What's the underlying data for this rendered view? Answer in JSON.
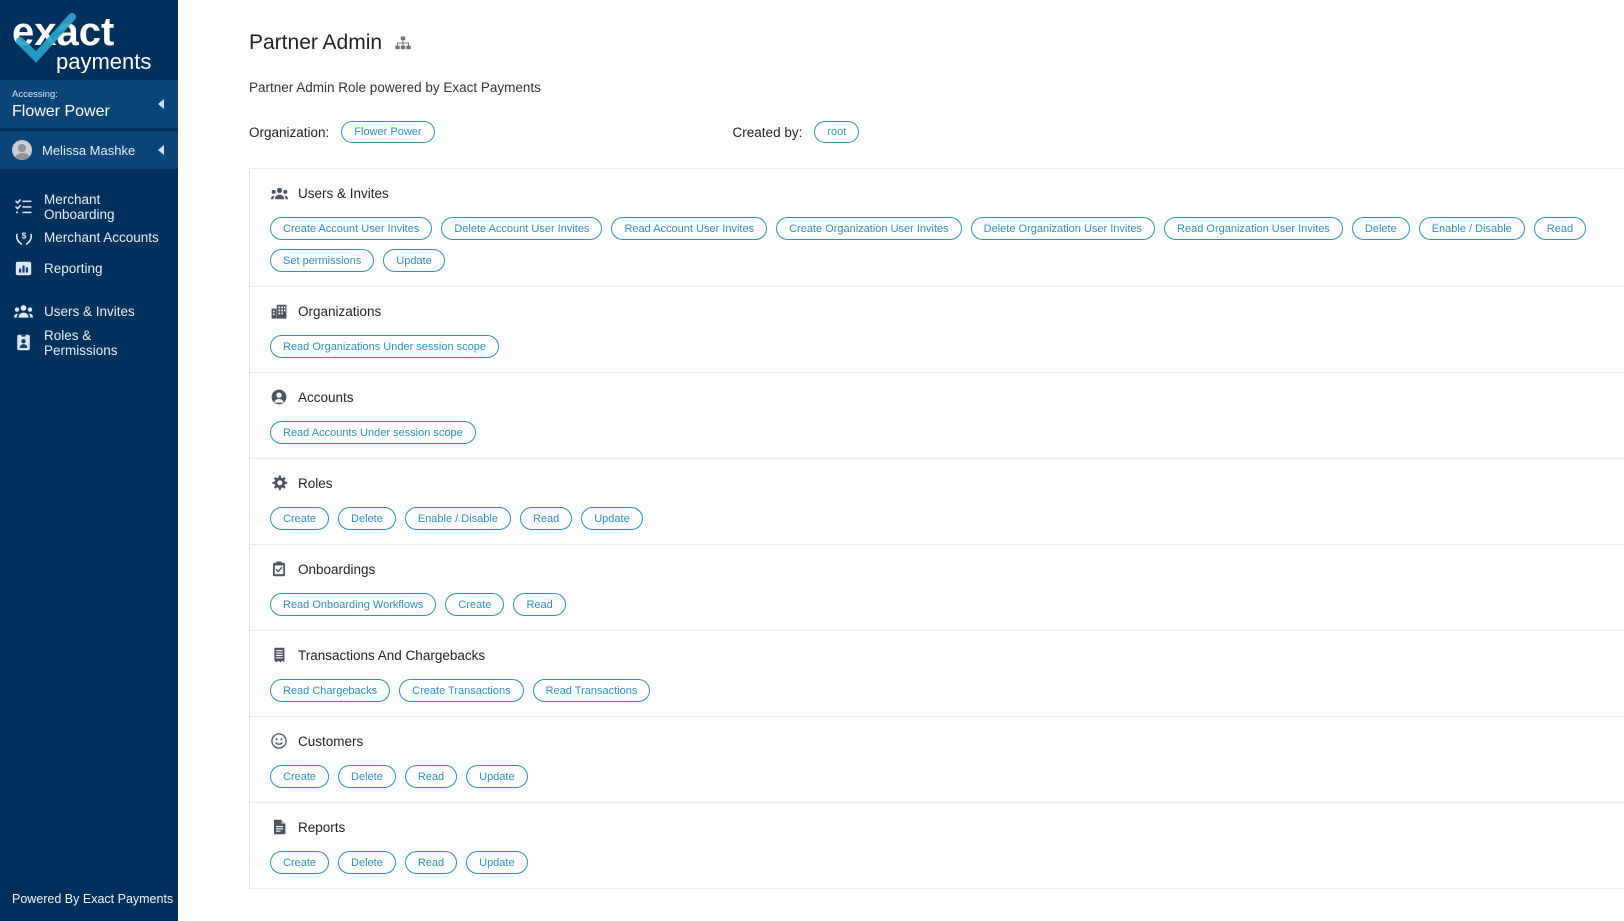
{
  "sidebar": {
    "logo": {
      "brand_top": "exact",
      "brand_bottom": "payments",
      "check_color": "#29a3c9"
    },
    "accessing_label": "Accessing:",
    "accessing_value": "Flower Power",
    "user_name": "Melissa Mashke",
    "nav_items": [
      {
        "label": "Merchant Onboarding",
        "icon": "checklist-icon"
      },
      {
        "label": "Merchant Accounts",
        "icon": "hand-money-icon"
      },
      {
        "label": "Reporting",
        "icon": "bar-chart-icon"
      },
      {
        "label": "Users & Invites",
        "icon": "users-icon"
      },
      {
        "label": "Roles & Permissions",
        "icon": "id-badge-icon"
      }
    ],
    "footer": "Powered By Exact Payments"
  },
  "page": {
    "title": "Partner Admin",
    "title_icon": "sitemap-icon",
    "subtitle": "Partner Admin Role powered by Exact Payments",
    "organization_label": "Organization:",
    "organization_value": "Flower Power",
    "created_by_label": "Created by:",
    "created_by_value": "root"
  },
  "colors": {
    "sidebar_bg": "#00305c",
    "sidebar_panel": "#0b4578",
    "accent": "#2f90bf",
    "divider": "#ededed"
  },
  "permission_groups": [
    {
      "title": "Users & Invites",
      "icon": "users-icon",
      "chips": [
        "Create Account User Invites",
        "Delete Account User Invites",
        "Read Account User Invites",
        "Create Organization User Invites",
        "Delete Organization User Invites",
        "Read Organization User Invites",
        "Delete",
        "Enable / Disable",
        "Read",
        "Set permissions",
        "Update"
      ]
    },
    {
      "title": "Organizations",
      "icon": "building-icon",
      "chips": [
        "Read Organizations Under session scope"
      ]
    },
    {
      "title": "Accounts",
      "icon": "user-circle-icon",
      "chips": [
        "Read Accounts Under session scope"
      ]
    },
    {
      "title": "Roles",
      "icon": "gear-icon",
      "chips": [
        "Create",
        "Delete",
        "Enable / Disable",
        "Read",
        "Update"
      ]
    },
    {
      "title": "Onboardings",
      "icon": "clipboard-check-icon",
      "chips": [
        "Read Onboarding Workflows",
        "Create",
        "Read"
      ]
    },
    {
      "title": "Transactions And Chargebacks",
      "icon": "receipt-icon",
      "chips": [
        "Read Chargebacks",
        "Create Transactions",
        "Read Transactions"
      ]
    },
    {
      "title": "Customers",
      "icon": "smiley-icon",
      "chips": [
        "Create",
        "Delete",
        "Read",
        "Update"
      ]
    },
    {
      "title": "Reports",
      "icon": "document-icon",
      "chips": [
        "Create",
        "Delete",
        "Read",
        "Update"
      ]
    }
  ]
}
